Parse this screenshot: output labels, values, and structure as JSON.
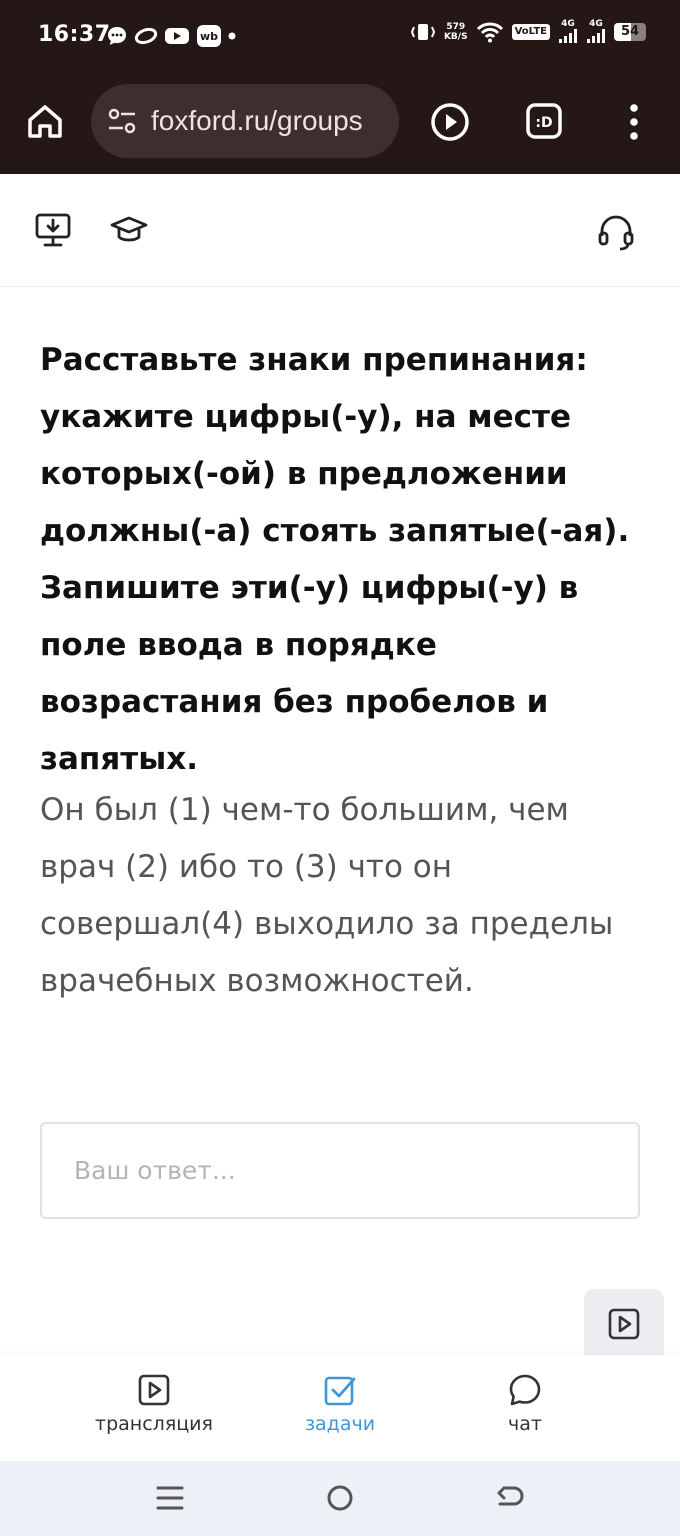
{
  "status_bar": {
    "time": "16:37",
    "net_speed_value": "579",
    "net_speed_unit": "KB/S",
    "volte": "VoLTE",
    "sim1_label": "4G",
    "sim2_label": "4G",
    "battery": "54",
    "battery_level_percent": 54
  },
  "browser": {
    "url": "foxford.ru/groups"
  },
  "task": {
    "title": "Расставьте знаки препинания: укажите  цифры(-у), на месте которых(-ой) в предложении должны(-а) стоять запятые(-ая). Запишите эти(-у) цифры(-у) в поле ввода в порядке возрастания без пробелов и запятых.",
    "sentence": "Он был (1) чем-то большим, чем врач (2) ибо то (3) что он совершал(4) выходило за пределы врачебных возможностей.",
    "answer_placeholder": "Ваш ответ...",
    "answer_value": ""
  },
  "bottom_nav": {
    "items": [
      {
        "label": "трансляция",
        "icon": "play-square-icon",
        "active": false
      },
      {
        "label": "задачи",
        "icon": "checkbox-icon",
        "active": true
      },
      {
        "label": "чат",
        "icon": "chat-bubble-icon",
        "active": false
      }
    ]
  },
  "colors": {
    "browser_chrome": "#261717",
    "url_pill": "#3f2e2e",
    "accent_active": "#3d97d6",
    "system_nav": "#eef0f7"
  }
}
